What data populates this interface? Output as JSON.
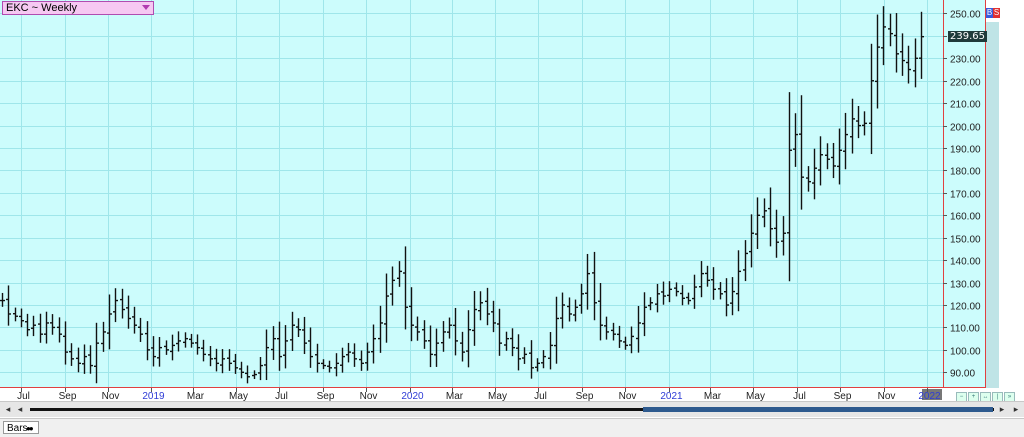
{
  "symbol_selector": {
    "label": "EKC ~ Weekly"
  },
  "last_price": {
    "label": "239.65"
  },
  "bs_badge": {
    "b": "B",
    "s": "S"
  },
  "status_bar": {
    "tab_label": "Bars"
  },
  "colors": {
    "background": "#ccfcfc",
    "grid": "#9fe6ea",
    "axis_line": "#e04040",
    "bars": "#111111",
    "year_label": "#2e3cd6",
    "month_label": "#222222"
  },
  "chart_data": {
    "type": "ohlc",
    "title": "EKC ~ Weekly",
    "interval": "weekly",
    "xlabel": "",
    "ylabel": "",
    "ylim": [
      83,
      256
    ],
    "yticks": [
      90,
      100,
      110,
      120,
      130,
      140,
      150,
      160,
      170,
      180,
      190,
      200,
      210,
      220,
      230,
      240,
      250
    ],
    "ytick_labels": [
      "90.00",
      "100.00",
      "110.00",
      "120.00",
      "130.00",
      "140.00",
      "150.00",
      "160.00",
      "170.00",
      "180.00",
      "190.00",
      "200.00",
      "210.00",
      "220.00",
      "230.00",
      "240.00",
      "250.00"
    ],
    "xticks": [
      {
        "date": "2018-07-01",
        "label": "Jul",
        "year": false
      },
      {
        "date": "2018-09-01",
        "label": "Sep",
        "year": false
      },
      {
        "date": "2018-11-01",
        "label": "Nov",
        "year": false
      },
      {
        "date": "2019-01-01",
        "label": "2019",
        "year": true
      },
      {
        "date": "2019-03-01",
        "label": "Mar",
        "year": false
      },
      {
        "date": "2019-05-01",
        "label": "May",
        "year": false
      },
      {
        "date": "2019-07-01",
        "label": "Jul",
        "year": false
      },
      {
        "date": "2019-09-01",
        "label": "Sep",
        "year": false
      },
      {
        "date": "2019-11-01",
        "label": "Nov",
        "year": false
      },
      {
        "date": "2020-01-01",
        "label": "2020",
        "year": true
      },
      {
        "date": "2020-03-01",
        "label": "Mar",
        "year": false
      },
      {
        "date": "2020-05-01",
        "label": "May",
        "year": false
      },
      {
        "date": "2020-07-01",
        "label": "Jul",
        "year": false
      },
      {
        "date": "2020-09-01",
        "label": "Sep",
        "year": false
      },
      {
        "date": "2020-11-01",
        "label": "Nov",
        "year": false
      },
      {
        "date": "2021-01-01",
        "label": "2021",
        "year": true
      },
      {
        "date": "2021-03-01",
        "label": "Mar",
        "year": false
      },
      {
        "date": "2021-05-01",
        "label": "May",
        "year": false
      },
      {
        "date": "2021-07-01",
        "label": "Jul",
        "year": false
      },
      {
        "date": "2021-09-01",
        "label": "Sep",
        "year": false
      },
      {
        "date": "2021-11-01",
        "label": "Nov",
        "year": false
      },
      {
        "date": "2022-01-01",
        "label": "2022",
        "year": true
      }
    ],
    "x_start": "2018-06-01",
    "x_end": "2022-01-24",
    "grid": true,
    "last_price": 239.65,
    "close_series": [
      122,
      116,
      115,
      113,
      109,
      111,
      107,
      112,
      110,
      107,
      99,
      96,
      94,
      97,
      93,
      103,
      108,
      116,
      122,
      118,
      114,
      111,
      107,
      100,
      97,
      101,
      100,
      102,
      104,
      105,
      103,
      101,
      98,
      96,
      94,
      96,
      94,
      92,
      90,
      88,
      89,
      93,
      101,
      105,
      97,
      104,
      111,
      109,
      103,
      97,
      94,
      93,
      92,
      94,
      97,
      99,
      96,
      94,
      99,
      105,
      112,
      124,
      131,
      135,
      119,
      111,
      108,
      104,
      98,
      103,
      108,
      111,
      104,
      99,
      109,
      118,
      121,
      116,
      112,
      103,
      105,
      101,
      96,
      98,
      92,
      94,
      97,
      102,
      114,
      120,
      116,
      119,
      125,
      134,
      121,
      111,
      108,
      107,
      104,
      102,
      106,
      112,
      119,
      121,
      125,
      124,
      127,
      126,
      123,
      122,
      128,
      134,
      131,
      127,
      125,
      120,
      126,
      135,
      143,
      152,
      160,
      162,
      154,
      148,
      152,
      189,
      196,
      177,
      175,
      181,
      187,
      185,
      182,
      189,
      196,
      203,
      200,
      201,
      220,
      235,
      244,
      241,
      232,
      229,
      225,
      230,
      239.65
    ]
  }
}
